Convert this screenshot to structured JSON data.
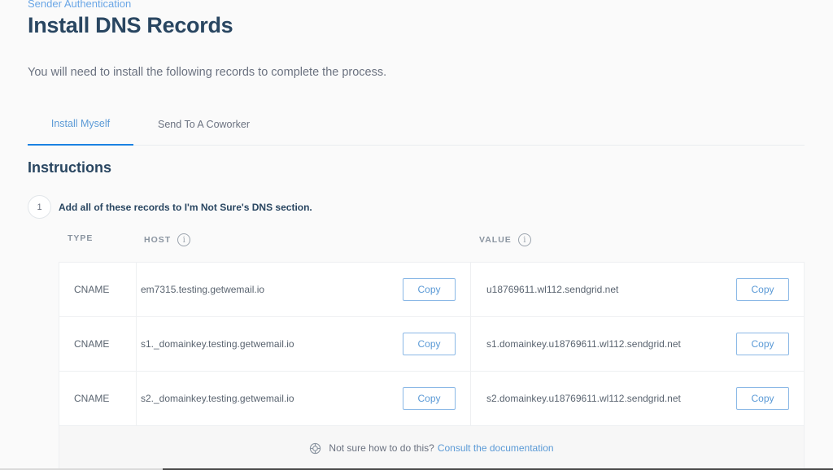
{
  "breadcrumb": "Sender Authentication",
  "title": "Install DNS Records",
  "intro": "You will need to install the following records to complete the process.",
  "tabs": [
    {
      "label": "Install Myself",
      "active": true
    },
    {
      "label": "Send To A Coworker",
      "active": false
    }
  ],
  "instructions": {
    "title": "Instructions",
    "step_number": "1",
    "step_text": "Add all of these records to I'm Not Sure's DNS section."
  },
  "table": {
    "headers": {
      "type": "TYPE",
      "host": "HOST",
      "value": "VALUE"
    },
    "info_icon": "info-icon",
    "copy_label": "Copy",
    "rows": [
      {
        "type": "CNAME",
        "host": "em7315.testing.getwemail.io",
        "value": "u18769611.wl112.sendgrid.net"
      },
      {
        "type": "CNAME",
        "host": "s1._domainkey.testing.getwemail.io",
        "value": "s1.domainkey.u18769611.wl112.sendgrid.net"
      },
      {
        "type": "CNAME",
        "host": "s2._domainkey.testing.getwemail.io",
        "value": "s2.domainkey.u18769611.wl112.sendgrid.net"
      }
    ],
    "footer": {
      "icon": "lifebuoy-icon",
      "text": "Not sure how to do this?",
      "link": "Consult the documentation"
    }
  },
  "colors": {
    "accent": "#1a82e2",
    "link": "#5b9ad6",
    "heading": "#294661"
  }
}
